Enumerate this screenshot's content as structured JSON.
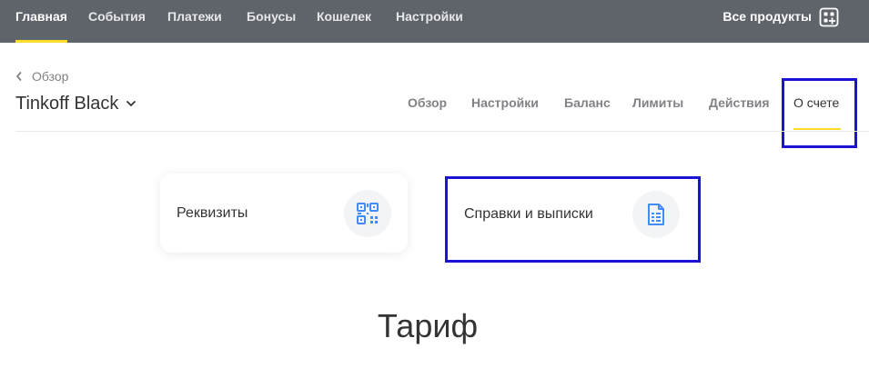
{
  "topnav": {
    "items": [
      {
        "label": "Главная",
        "active": true
      },
      {
        "label": "События",
        "active": false
      },
      {
        "label": "Платежи",
        "active": false
      },
      {
        "label": "Бонусы",
        "active": false
      },
      {
        "label": "Кошелек",
        "active": false
      },
      {
        "label": "Настройки",
        "active": false
      }
    ],
    "all_products": "Все продукты",
    "all_products_icon": "apps-plus-icon"
  },
  "breadcrumb": {
    "label": "Обзор",
    "icon": "chevron-left-icon"
  },
  "product": {
    "title": "Tinkoff Black",
    "icon": "chevron-down-icon"
  },
  "subnav": {
    "items": [
      {
        "label": "Обзор",
        "active": false
      },
      {
        "label": "Настройки",
        "active": false
      },
      {
        "label": "Баланс",
        "active": false
      },
      {
        "label": "Лимиты",
        "active": false
      },
      {
        "label": "Действия",
        "active": false
      },
      {
        "label": "О счете",
        "active": true
      }
    ]
  },
  "cards": [
    {
      "label": "Реквизиты",
      "icon": "qr-code-icon"
    },
    {
      "label": "Справки и выписки",
      "icon": "document-icon"
    }
  ],
  "section": {
    "title": "Тариф"
  },
  "colors": {
    "topbar": "#5f646b",
    "accent": "#ffdd2d",
    "icon": "#428bf9",
    "highlight": "#1a12d6"
  }
}
